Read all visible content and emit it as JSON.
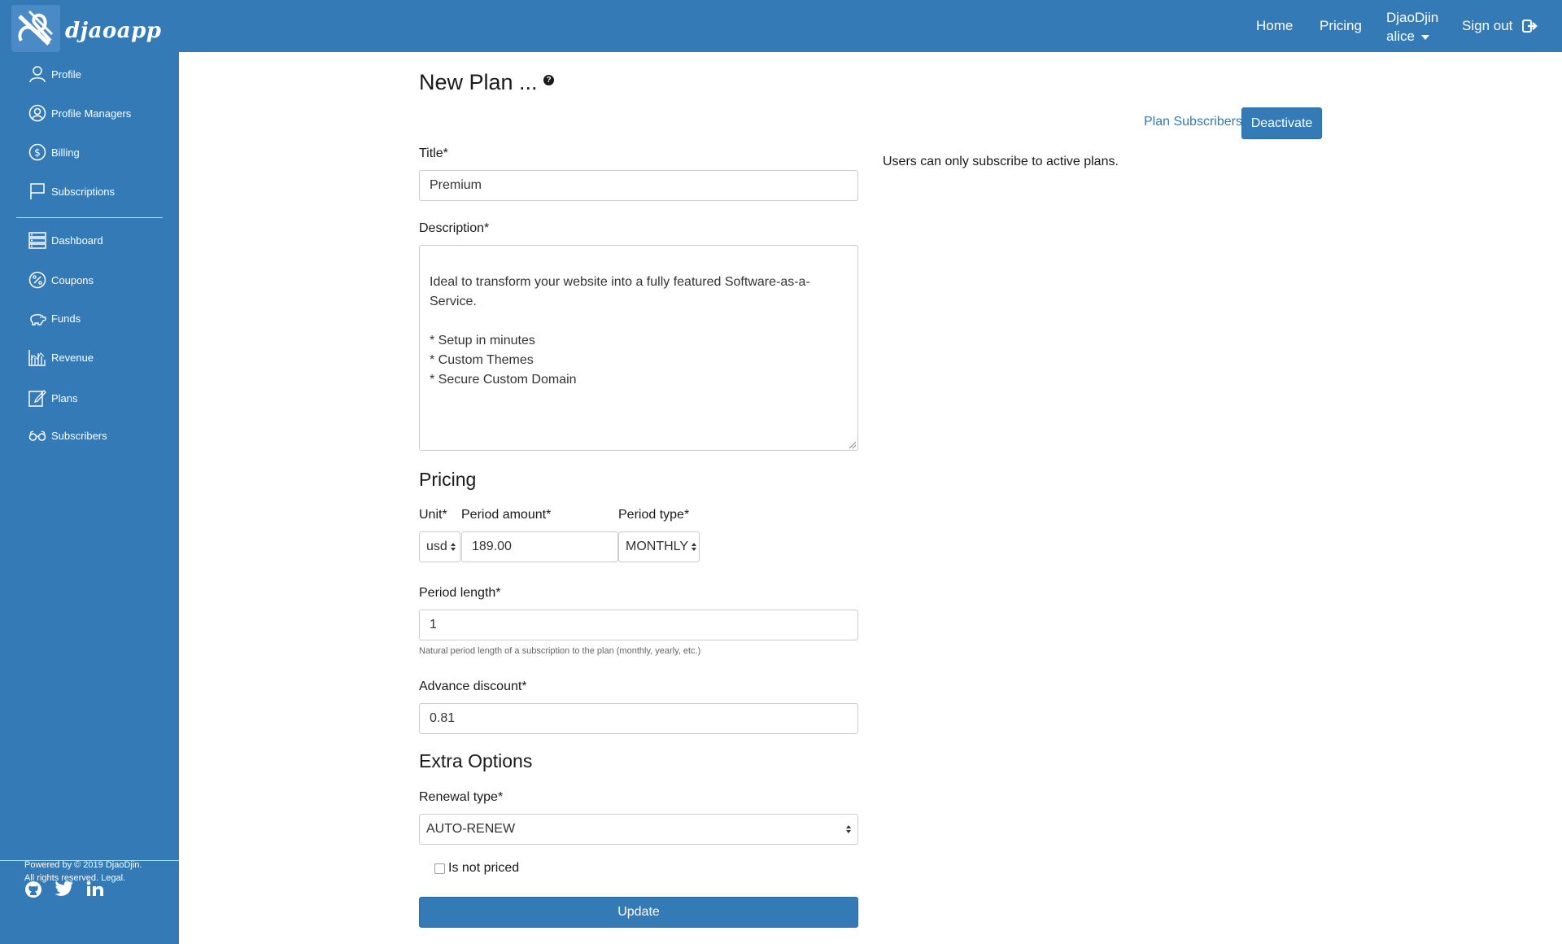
{
  "brand": {
    "name": "djaoapp"
  },
  "topnav": {
    "home": "Home",
    "pricing": "Pricing",
    "org": "DjaoDjin",
    "user": "alice",
    "signout": "Sign out"
  },
  "sidebar": {
    "items": [
      {
        "label": "Profile",
        "icon": "user-icon"
      },
      {
        "label": "Profile Managers",
        "icon": "user-circle-icon"
      },
      {
        "label": "Billing",
        "icon": "dollar-circle-icon"
      },
      {
        "label": "Subscriptions",
        "icon": "flag-icon"
      },
      {
        "label": "Dashboard",
        "icon": "server-icon"
      },
      {
        "label": "Coupons",
        "icon": "percent-icon"
      },
      {
        "label": "Funds",
        "icon": "piggy-bank-icon"
      },
      {
        "label": "Revenue",
        "icon": "chart-icon"
      },
      {
        "label": "Plans",
        "icon": "edit-icon"
      },
      {
        "label": "Subscribers",
        "icon": "glasses-icon"
      }
    ],
    "footer_line1": "Powered by © 2019 DjaoDjin.",
    "footer_line2": "All rights reserved. Legal."
  },
  "page": {
    "title": "New Plan ...",
    "help": "?",
    "plan_subscribers_link": "Plan Subscribers",
    "deactivate_button": "Deactivate",
    "note": "Users can only subscribe to active plans."
  },
  "form": {
    "title_label": "Title*",
    "title_value": "Premium",
    "description_label": "Description*",
    "description_value": "Ideal to transform your website into a fully featured Software-as-a-Service.\n\n* Setup in minutes\n* Custom Themes\n* Secure Custom Domain",
    "pricing_heading": "Pricing",
    "unit_label": "Unit*",
    "unit_value": "usd",
    "period_amount_label": "Period amount*",
    "period_amount_value": "189.00",
    "period_type_label": "Period type*",
    "period_type_value": "MONTHLY",
    "period_length_label": "Period length*",
    "period_length_value": "1",
    "period_length_help": "Natural period length of a subscription to the plan (monthly, yearly, etc.)",
    "advance_discount_label": "Advance discount*",
    "advance_discount_value": "0.81",
    "extra_heading": "Extra Options",
    "renewal_type_label": "Renewal type*",
    "renewal_type_value": "AUTO-RENEW",
    "not_priced_label": "Is not priced",
    "update_button": "Update"
  },
  "colors": {
    "primary": "#337ab7",
    "text": "#1a1a1a"
  }
}
